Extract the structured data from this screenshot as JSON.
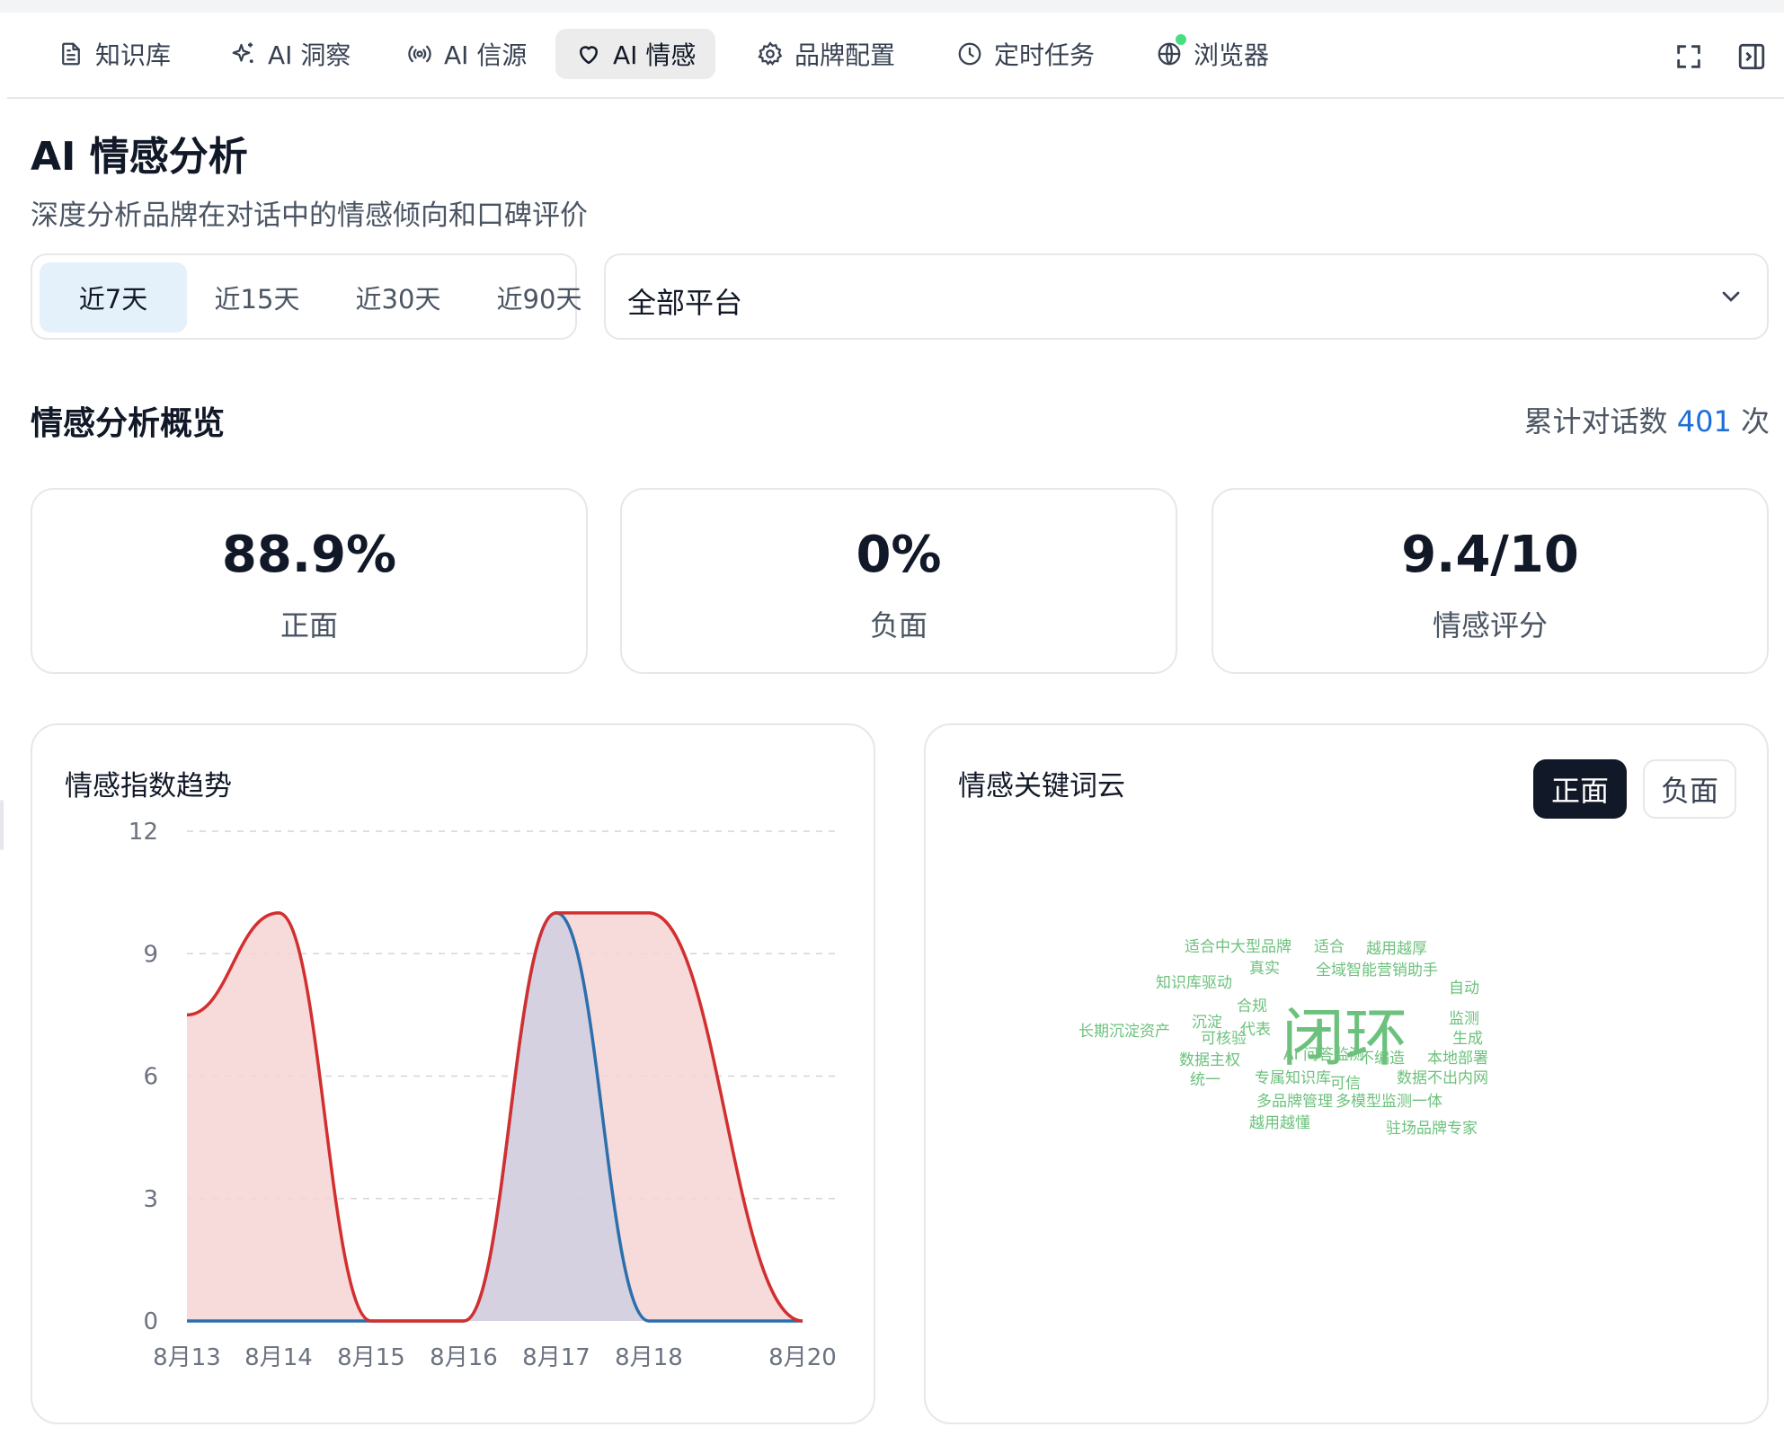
{
  "nav": {
    "tabs": [
      {
        "label": "知识库",
        "icon": "document-icon"
      },
      {
        "label": "AI 洞察",
        "icon": "sparkles-icon"
      },
      {
        "label": "AI 信源",
        "icon": "broadcast-icon"
      },
      {
        "label": "AI 情感",
        "icon": "heart-icon",
        "active": true
      },
      {
        "label": "品牌配置",
        "icon": "gear-icon"
      },
      {
        "label": "定时任务",
        "icon": "clock-icon"
      },
      {
        "label": "浏览器",
        "icon": "globe-icon"
      }
    ],
    "tools": [
      "fullscreen-icon",
      "sidebar-panel-icon"
    ]
  },
  "header": {
    "title": "AI 情感分析",
    "subtitle": "深度分析品牌在对话中的情感倾向和口碑评价"
  },
  "filters": {
    "ranges": [
      "近7天",
      "近15天",
      "近30天",
      "近90天"
    ],
    "active_range": "近7天",
    "platform": "全部平台"
  },
  "overview": {
    "title": "情感分析概览",
    "total_prefix": "累计对话数",
    "total_count": "401",
    "total_suffix": "次"
  },
  "stats": [
    {
      "value": "88.9%",
      "label": "正面"
    },
    {
      "value": "0%",
      "label": "负面"
    },
    {
      "value": "9.4/10",
      "label": "情感评分"
    }
  ],
  "trend": {
    "title": "情感指数趋势"
  },
  "chart_data": {
    "type": "area",
    "x": [
      "8月13",
      "8月14",
      "8月15",
      "8月16",
      "8月17",
      "8月18",
      "8月20"
    ],
    "ylim": [
      0,
      12
    ],
    "yticks": [
      0,
      3,
      6,
      9,
      12
    ],
    "series": [
      {
        "color": "#d32f2f",
        "fill": "#f6d4d4",
        "values": [
          7.5,
          10,
          0,
          0,
          10,
          10,
          0
        ]
      },
      {
        "color": "#2c6fad",
        "fill": "#c8cde4",
        "values": [
          0,
          0,
          0,
          0,
          10,
          0,
          0
        ]
      }
    ],
    "grid": true,
    "grid_style": "dashed"
  },
  "wordcloud": {
    "title": "情感关键词云",
    "toggle_positive": "正面",
    "toggle_negative": "负面",
    "color": "#6cc17c",
    "words": [
      {
        "text": "适合中大型品牌",
        "size": 17
      },
      {
        "text": "适合",
        "size": 17
      },
      {
        "text": "越用越厚",
        "size": 17
      },
      {
        "text": "真实",
        "size": 17
      },
      {
        "text": "全域智能营销助手",
        "size": 17
      },
      {
        "text": "知识库驱动",
        "size": 17
      },
      {
        "text": "自动",
        "size": 17
      },
      {
        "text": "合规",
        "size": 17
      },
      {
        "text": "沉淀",
        "size": 17
      },
      {
        "text": "代表",
        "size": 17
      },
      {
        "text": "闭环",
        "size": 70
      },
      {
        "text": "监测",
        "size": 17
      },
      {
        "text": "长期沉淀资产",
        "size": 17
      },
      {
        "text": "可核验",
        "size": 17
      },
      {
        "text": "生成",
        "size": 17
      },
      {
        "text": "数据主权",
        "size": 17
      },
      {
        "text": "AI 问答监测",
        "size": 17
      },
      {
        "text": "不编造",
        "size": 17
      },
      {
        "text": "本地部署",
        "size": 17
      },
      {
        "text": "统一",
        "size": 17
      },
      {
        "text": "专属知识库",
        "size": 17
      },
      {
        "text": "可信",
        "size": 17
      },
      {
        "text": "数据不出内网",
        "size": 17
      },
      {
        "text": "多品牌管理",
        "size": 17
      },
      {
        "text": "多模型监测一体",
        "size": 17
      },
      {
        "text": "越用越懂",
        "size": 17
      },
      {
        "text": "驻场品牌专家",
        "size": 17
      }
    ]
  }
}
